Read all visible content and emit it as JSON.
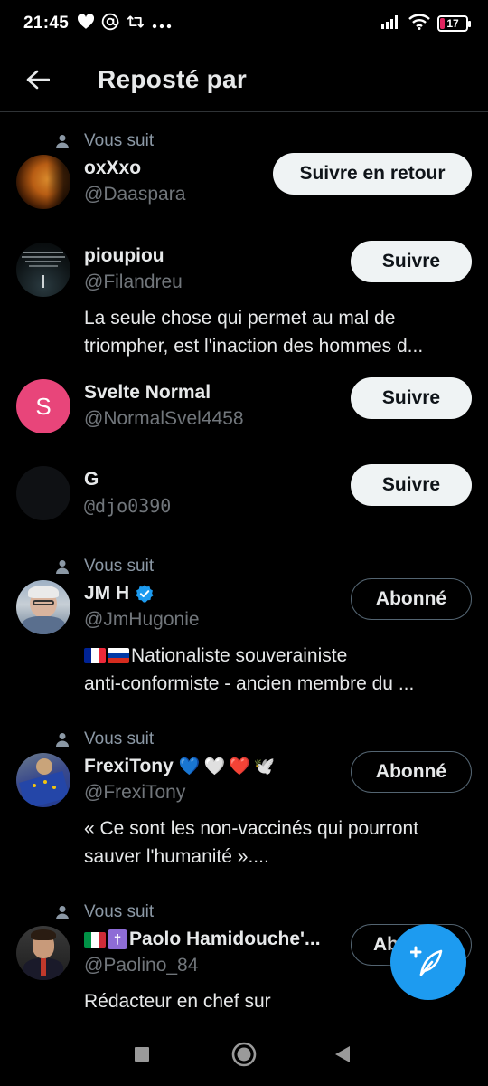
{
  "status_bar": {
    "time": "21:45",
    "battery_level": "17",
    "icons": [
      "heart-icon",
      "at-icon",
      "repost-icon",
      "more-dots-icon",
      "signal-icon",
      "wifi-icon",
      "battery-icon"
    ]
  },
  "header": {
    "title": "Reposté par",
    "back_icon": "arrow-left-icon"
  },
  "users": [
    {
      "follows_you_label": "Vous suit",
      "name": "oxXxo",
      "handle": "@Daaspara",
      "button_label": "Suivre en retour",
      "bio_lines": []
    },
    {
      "name": "pioupiou",
      "handle": "@Filandreu",
      "button_label": "Suivre",
      "bio_lines": [
        "La seule chose qui permet au mal de",
        "triompher, est l'inaction des hommes d..."
      ]
    },
    {
      "name": "Svelte Normal",
      "avatar_letter": "S",
      "handle": "@NormalSvel4458",
      "button_label": "Suivre",
      "bio_lines": []
    },
    {
      "name": "G",
      "handle": "@djo0390",
      "button_label": "Suivre",
      "bio_lines": []
    },
    {
      "follows_you_label": "Vous suit",
      "name": "JM H",
      "handle": "@JmHugonie",
      "button_label": "Abonné",
      "verified": true,
      "bio_lines": [
        "Nationaliste souverainiste",
        "anti-conformiste - ancien membre du ..."
      ]
    },
    {
      "follows_you_label": "Vous suit",
      "name": "FrexiTony",
      "handle": "@FrexiTony",
      "button_label": "Abonné",
      "name_emojis": [
        "💙",
        "🤍",
        "❤️",
        "🕊️"
      ],
      "bio_lines": [
        "« Ce sont les non-vaccinés qui pourront",
        "sauver l'humanité »...."
      ]
    },
    {
      "follows_you_label": "Vous suit",
      "name": "Paolo Hamidouche'...",
      "handle": "@Paolino_84",
      "button_label": "Abonné",
      "bio_lines": [
        "Rédacteur en chef sur"
      ]
    }
  ],
  "compose_button": {
    "icon": "compose-feather-icon"
  },
  "nav_bar": {
    "buttons": [
      "recents-square-icon",
      "home-circle-icon",
      "back-triangle-icon"
    ]
  },
  "colors": {
    "background": "#000000",
    "accent": "#1d9bf0",
    "secondary_text": "#71767b",
    "battery_low": "#e0245e"
  }
}
